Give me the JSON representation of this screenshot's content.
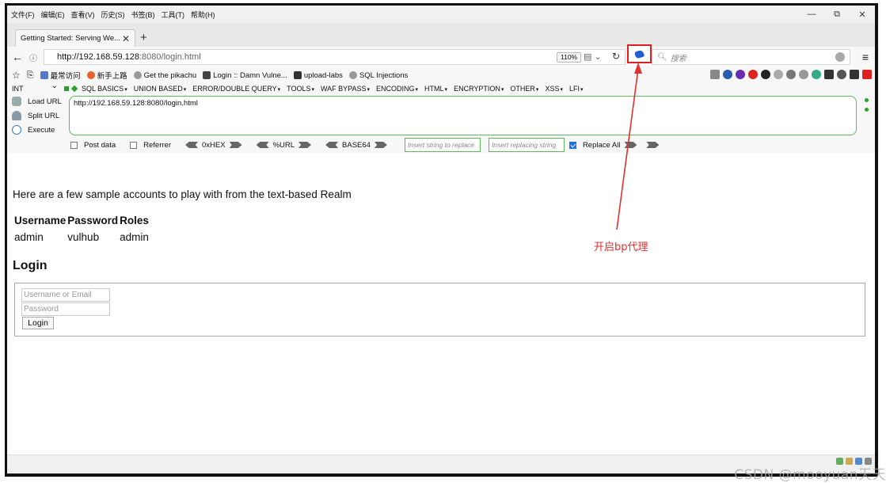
{
  "menubar": {
    "items": [
      "文件(F)",
      "编辑(E)",
      "查看(V)",
      "历史(S)",
      "书签(B)",
      "工具(T)",
      "帮助(H)"
    ]
  },
  "window_controls": {
    "minimize": "—",
    "restore": "⧉",
    "close": "✕"
  },
  "tab": {
    "title": "Getting Started: Serving We...",
    "close": "✕",
    "new_tab": "+"
  },
  "nav": {
    "url_host": "http://192.168.59.128",
    "url_rest": ":8080/login.html",
    "zoom": "110%",
    "search_placeholder": "搜索"
  },
  "bookmarks": [
    {
      "label": "最常访问",
      "color": "#5577cc"
    },
    {
      "label": "新手上路",
      "color": "#e8632b"
    },
    {
      "label": "Get the pikachu",
      "color": "#888888"
    },
    {
      "label": "Login :: Damn Vulne...",
      "color": "#444444"
    },
    {
      "label": "upload-labs",
      "color": "#333333"
    },
    {
      "label": "SQL Injections",
      "color": "#888888"
    }
  ],
  "hackbar": {
    "select_value": "INT",
    "menus": [
      "SQL BASICS",
      "UNION BASED",
      "ERROR/DOUBLE QUERY",
      "TOOLS",
      "WAF BYPASS",
      "ENCODING",
      "HTML",
      "ENCRYPTION",
      "OTHER",
      "XSS",
      "LFI"
    ],
    "load_url": "Load URL",
    "split_url": "Split URL",
    "execute": "Execute",
    "url_value": "http://192.168.59.128:8080/login.html",
    "post_data": "Post data",
    "referrer": "Referrer",
    "encodings": [
      "0xHEX",
      "%URL",
      "BASE64"
    ],
    "insert_placeholder": "Insert string to replace",
    "replace_placeholder": "Insert replacing string",
    "replace_all": "Replace All"
  },
  "page": {
    "intro": "Here are a few sample accounts to play with from the text-based Realm",
    "table": {
      "headers": [
        "Username",
        "Password",
        "Roles"
      ],
      "rows": [
        [
          "admin",
          "vulhub",
          "admin"
        ]
      ]
    },
    "login_heading": "Login",
    "username_placeholder": "Username or Email",
    "password_placeholder": "Password",
    "login_button": "Login"
  },
  "annotation": {
    "text": "开启bp代理",
    "color": "#e03030"
  },
  "watermark": "CSDN @mooyuan天天"
}
